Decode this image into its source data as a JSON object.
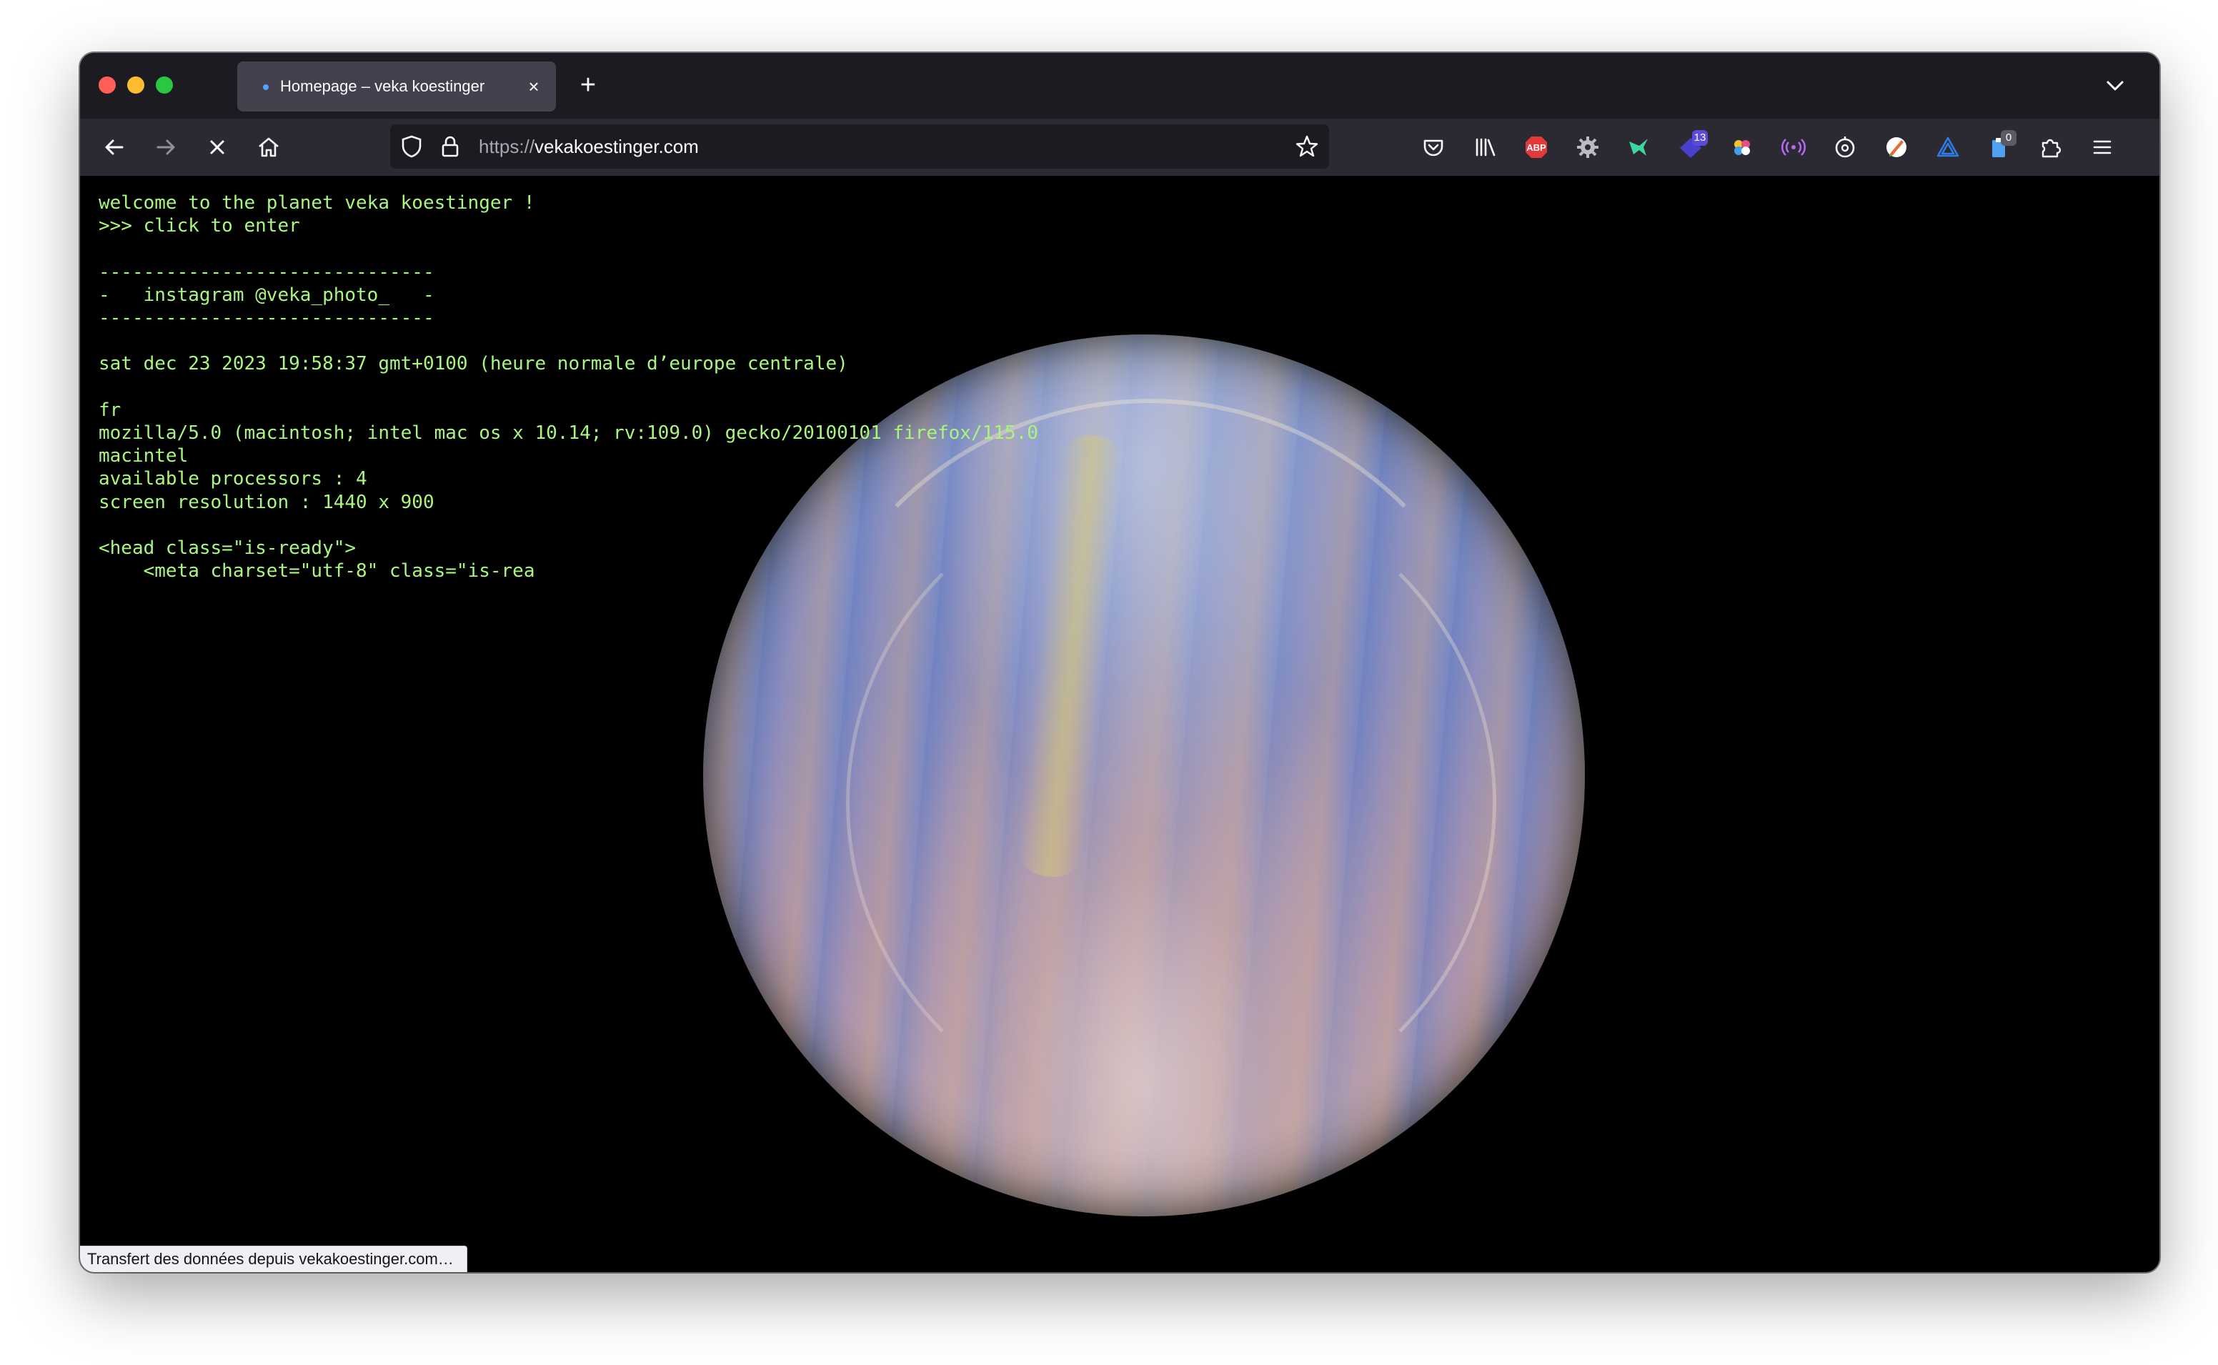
{
  "browser": {
    "tab": {
      "title": "Homepage – veka koestinger"
    },
    "url": {
      "scheme": "https://",
      "host": "vekakoestinger.com"
    },
    "toolbar_icons": [
      "back-icon",
      "forward-icon",
      "stop-icon",
      "home-icon",
      "shield-icon",
      "lock-icon",
      "bookmark-star-icon",
      "pocket-icon",
      "library-icon",
      "adblock-icon",
      "gear-extension-icon",
      "hummingbird-extension-icon",
      "notifications-extension-icon",
      "colors-extension-icon",
      "radio-extension-icon",
      "timer-extension-icon",
      "pen-extension-icon",
      "triangle-extension-icon",
      "clipboard-extension-icon",
      "puzzle-icon",
      "hamburger-menu-icon"
    ],
    "badges": {
      "notifications": "13",
      "clipboard": "0"
    },
    "extension_labels": {
      "adblock": "ABP"
    }
  },
  "page": {
    "lines": [
      "welcome to the planet veka koestinger !",
      ">>> click to enter",
      "",
      "------------------------------",
      "-   instagram @veka_photo_   -",
      "------------------------------",
      "",
      "sat dec 23 2023 19:58:37 gmt+0100 (heure normale d’europe centrale)",
      "",
      "fr",
      "mozilla/5.0 (macintosh; intel mac os x 10.14; rv:109.0) gecko/20100101 firefox/115.0",
      "macintel",
      "available processors : 4",
      "screen resolution : 1440 x 900",
      "",
      "<head class=\"is-ready\">",
      "    <meta charset=\"utf-8\" class=\"is-rea"
    ],
    "text_color": "#a8f77a"
  },
  "status": {
    "text": "Transfert des données depuis vekakoestinger.com…"
  }
}
